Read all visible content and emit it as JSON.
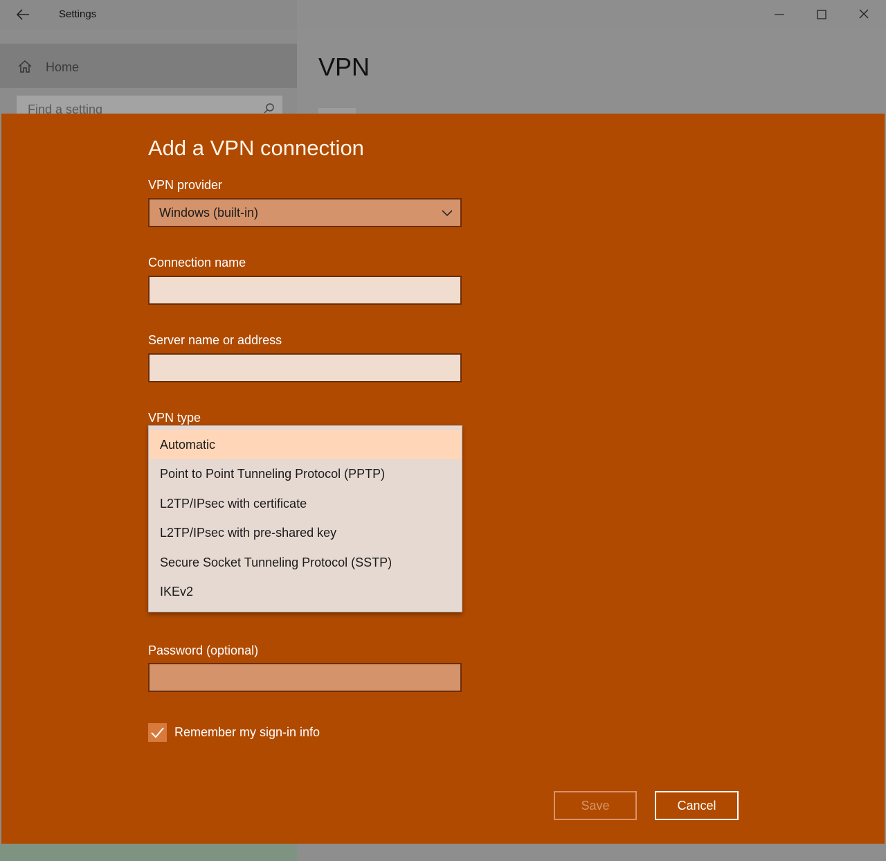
{
  "window": {
    "title": "Settings",
    "back_icon": "back-arrow-icon",
    "controls": [
      "minimize-icon",
      "maximize-icon",
      "close-icon"
    ]
  },
  "sidebar": {
    "home_label": "Home",
    "search_placeholder": "Find a setting"
  },
  "main": {
    "page_title": "VPN"
  },
  "dialog": {
    "title": "Add a VPN connection",
    "provider": {
      "label": "VPN provider",
      "value": "Windows (built-in)"
    },
    "connection_name": {
      "label": "Connection name",
      "value": ""
    },
    "server": {
      "label": "Server name or address",
      "value": ""
    },
    "vpn_type": {
      "label": "VPN type",
      "options": [
        "Automatic",
        "Point to Point Tunneling Protocol (PPTP)",
        "L2TP/IPsec with certificate",
        "L2TP/IPsec with pre-shared key",
        "Secure Socket Tunneling Protocol (SSTP)",
        "IKEv2"
      ],
      "selected": "Automatic"
    },
    "password": {
      "label": "Password (optional)",
      "value": ""
    },
    "remember": {
      "label": "Remember my sign-in info",
      "checked": true
    },
    "save_label": "Save",
    "cancel_label": "Cancel"
  },
  "colors": {
    "dialog_bg": "#b04a00",
    "accent_check": "#d97a3d",
    "dropdown_selected": "#ffd6b8"
  }
}
